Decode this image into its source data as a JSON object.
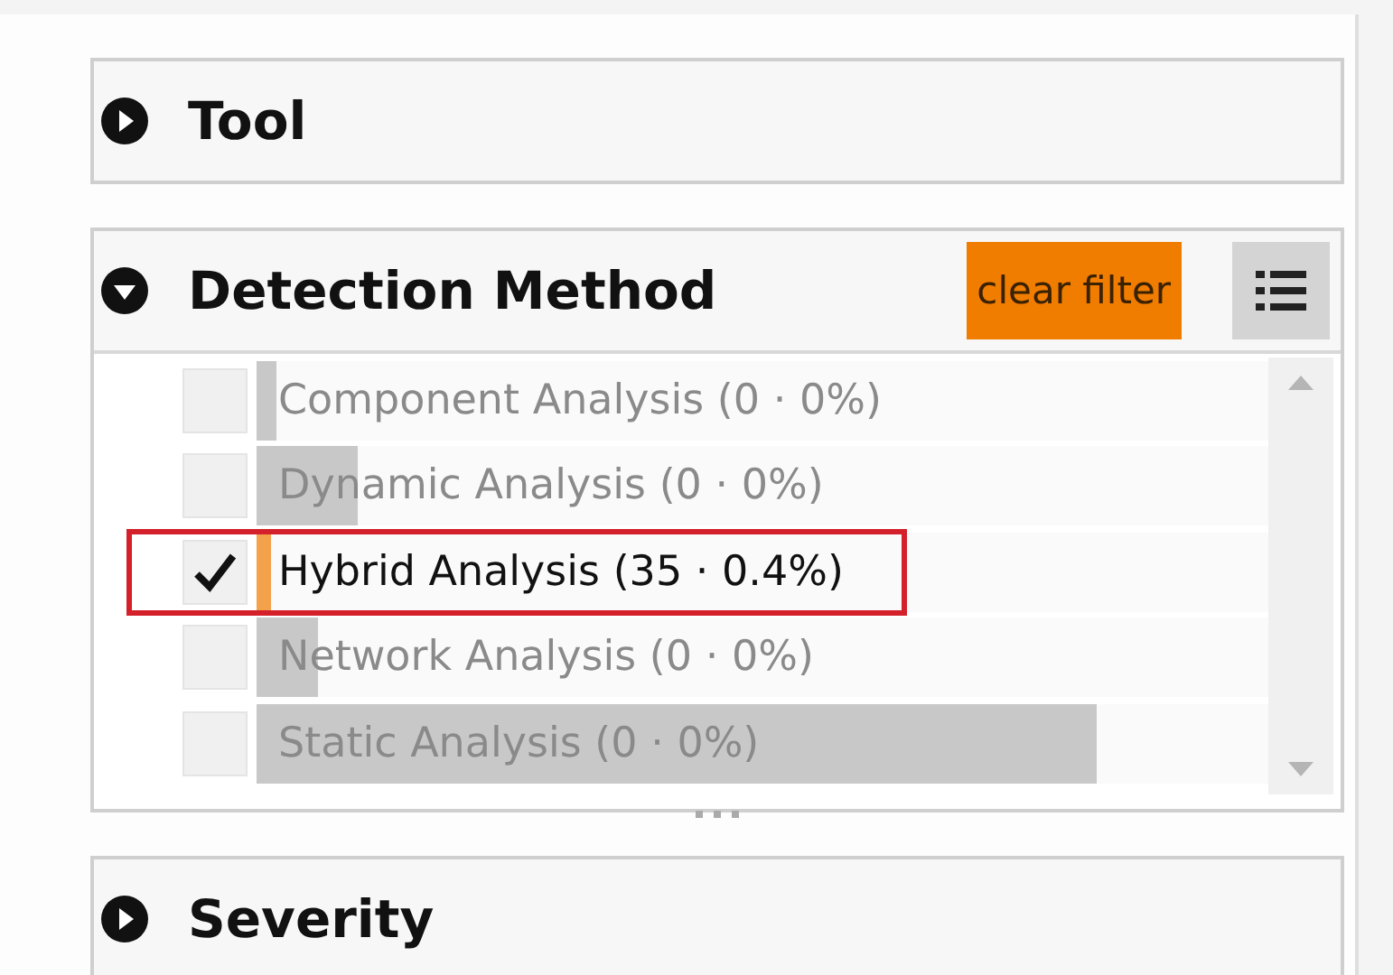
{
  "panels": [
    {
      "title": "Tool",
      "expanded": false
    },
    {
      "title": "Detection Method",
      "expanded": true,
      "clear_button": "clear filter",
      "items": [
        {
          "label": "Component Analysis (0 · 0%)",
          "checked": false,
          "highlighted": false,
          "level": 0.02
        },
        {
          "label": "Dynamic Analysis (0 · 0%)",
          "checked": false,
          "highlighted": false,
          "level": 0.1
        },
        {
          "label": "Hybrid Analysis (35 · 0.4%)",
          "checked": true,
          "highlighted": true,
          "level": 0.015
        },
        {
          "label": "Network Analysis (0 · 0%)",
          "checked": false,
          "highlighted": false,
          "level": 0.06
        },
        {
          "label": "Static Analysis (0 · 0%)",
          "checked": false,
          "highlighted": false,
          "level": 0.83
        }
      ]
    },
    {
      "title": "Severity",
      "expanded": false
    }
  ]
}
